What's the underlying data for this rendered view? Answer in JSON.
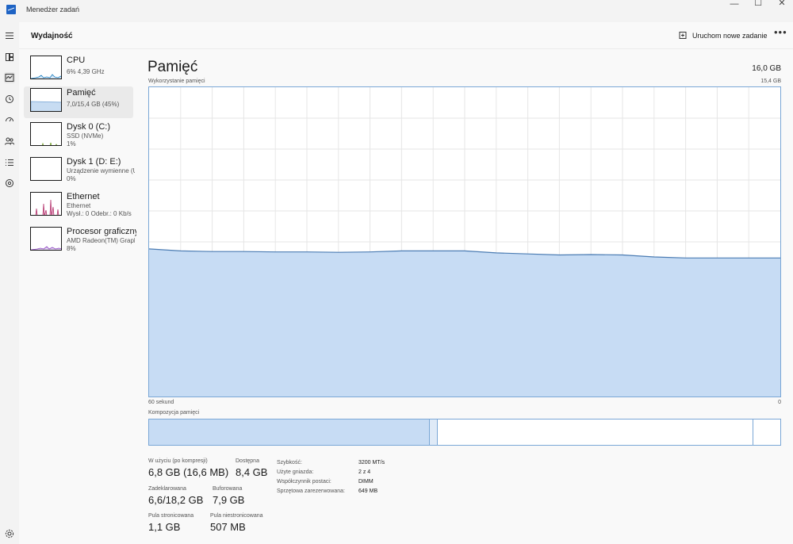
{
  "window": {
    "title": "Menedżer zadań",
    "minimize": "—",
    "maximize": "☐",
    "close": "✕"
  },
  "header": {
    "section": "Wydajność",
    "run_task": "Uruchom nowe zadanie",
    "more": "•••"
  },
  "rail_icons": [
    "hamburger-menu-icon",
    "processes-icon",
    "performance-icon",
    "app-history-icon",
    "startup-apps-icon",
    "users-icon",
    "details-icon",
    "services-icon",
    "settings-icon"
  ],
  "sidebar": [
    {
      "name": "CPU",
      "sub1": "6% 4,39 GHz",
      "sub2": "",
      "color": "#1e7fc1",
      "active": false
    },
    {
      "name": "Pamięć",
      "sub1": "7,0/15,4 GB (45%)",
      "sub2": "",
      "color": "#7aa7d6",
      "active": true
    },
    {
      "name": "Dysk 0 (C:)",
      "sub1": "SSD (NVMe)",
      "sub2": "1%",
      "color": "#6a9a1f",
      "active": false
    },
    {
      "name": "Dysk 1 (D: E:)",
      "sub1": "Urządzenie wymienne (U",
      "sub2": "0%",
      "color": "#6a9a1f",
      "active": false
    },
    {
      "name": "Ethernet",
      "sub1": "Ethernet",
      "sub2": "Wysł.: 0 Odebr.: 0 Kb/s",
      "color": "#b3306b",
      "active": false
    },
    {
      "name": "Procesor graficzny",
      "sub1": "AMD Radeon(TM) Graph",
      "sub2": "8%",
      "color": "#8a3fbf",
      "active": false
    }
  ],
  "main": {
    "title": "Pamięć",
    "total": "16,0 GB",
    "graph_label": "Wykorzystanie pamięci",
    "graph_max": "15,4 GB",
    "axis_left": "60 sekund",
    "axis_right": "0",
    "composition_label": "Kompozycja pamięci",
    "composition": [
      {
        "name": "in-use",
        "fraction": 0.443
      },
      {
        "name": "modified",
        "fraction": 0.014
      },
      {
        "name": "standby",
        "fraction": 0.5
      },
      {
        "name": "free",
        "fraction": 0.043
      }
    ],
    "stats": {
      "in_use_label": "W użyciu (po kompresji)",
      "in_use": "6,8 GB (16,6 MB)",
      "available_label": "Dostępna",
      "available": "8,4 GB",
      "committed_label": "Zadeklarowana",
      "committed": "6,6/18,2 GB",
      "cached_label": "Buforowana",
      "cached": "7,9 GB",
      "paged_label": "Pula stronicowana",
      "paged": "1,1 GB",
      "nonpaged_label": "Pula niestronicowana",
      "nonpaged": "507 MB"
    },
    "details": [
      {
        "key": "Szybkość:",
        "value": "3200 MT/s"
      },
      {
        "key": "Użyte gniazda:",
        "value": "2 z 4"
      },
      {
        "key": "Współczynnik postaci:",
        "value": "DIMM"
      },
      {
        "key": "Sprzętowa zarezerwowana:",
        "value": "649 MB"
      }
    ]
  },
  "chart_data": {
    "type": "area",
    "x": [
      60,
      57,
      54,
      51,
      48,
      45,
      42,
      39,
      36,
      33,
      30,
      27,
      24,
      21,
      18,
      15,
      12,
      9,
      6,
      3,
      0
    ],
    "values": [
      7.35,
      7.25,
      7.22,
      7.22,
      7.2,
      7.2,
      7.18,
      7.2,
      7.25,
      7.25,
      7.25,
      7.15,
      7.1,
      7.05,
      7.07,
      7.05,
      6.95,
      6.9,
      6.9,
      6.9,
      6.9
    ],
    "ylim": [
      0,
      15.4
    ],
    "grid": true
  }
}
